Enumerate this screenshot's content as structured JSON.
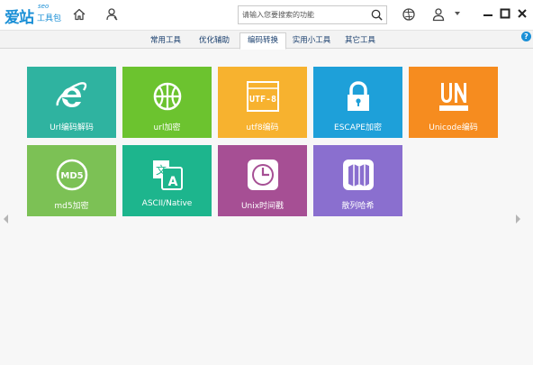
{
  "app": {
    "logo_main": "爱站",
    "logo_seo": "seo",
    "logo_sub": "工具包"
  },
  "toolbar": {
    "home_icon": "home-icon",
    "user_icon": "user-outline-icon",
    "globe_icon": "globe-icon",
    "account_icon": "account-icon"
  },
  "search": {
    "placeholder": "请输入您要搜索的功能",
    "value": ""
  },
  "tabs": [
    {
      "label": "常用工具"
    },
    {
      "label": "优化辅助"
    },
    {
      "label": "编码转换"
    },
    {
      "label": "实用小工具"
    },
    {
      "label": "其它工具"
    }
  ],
  "active_tab": "编码转换",
  "help_label": "?",
  "tiles": [
    {
      "label": "Url编码解码",
      "color": "#2fb3a0",
      "icon": "ie-icon"
    },
    {
      "label": "url加密",
      "color": "#6cc32f",
      "icon": "basketball-icon"
    },
    {
      "label": "utf8编码",
      "color": "#f7b22f",
      "icon": "utf8-icon"
    },
    {
      "label": "ESCAPE加密",
      "color": "#1ea0d9",
      "icon": "lock-icon"
    },
    {
      "label": "Unicode编码",
      "color": "#f68c1f",
      "icon": "unicode-icon"
    },
    {
      "label": "md5加密",
      "color": "#7cc155",
      "icon": "md5-icon"
    },
    {
      "label": "ASCII/Native",
      "color": "#1db58d",
      "icon": "translate-icon"
    },
    {
      "label": "Unix时间戳",
      "color": "#a64f94",
      "icon": "clock-icon"
    },
    {
      "label": "散列哈希",
      "color": "#8a6fcf",
      "icon": "map-icon"
    }
  ]
}
